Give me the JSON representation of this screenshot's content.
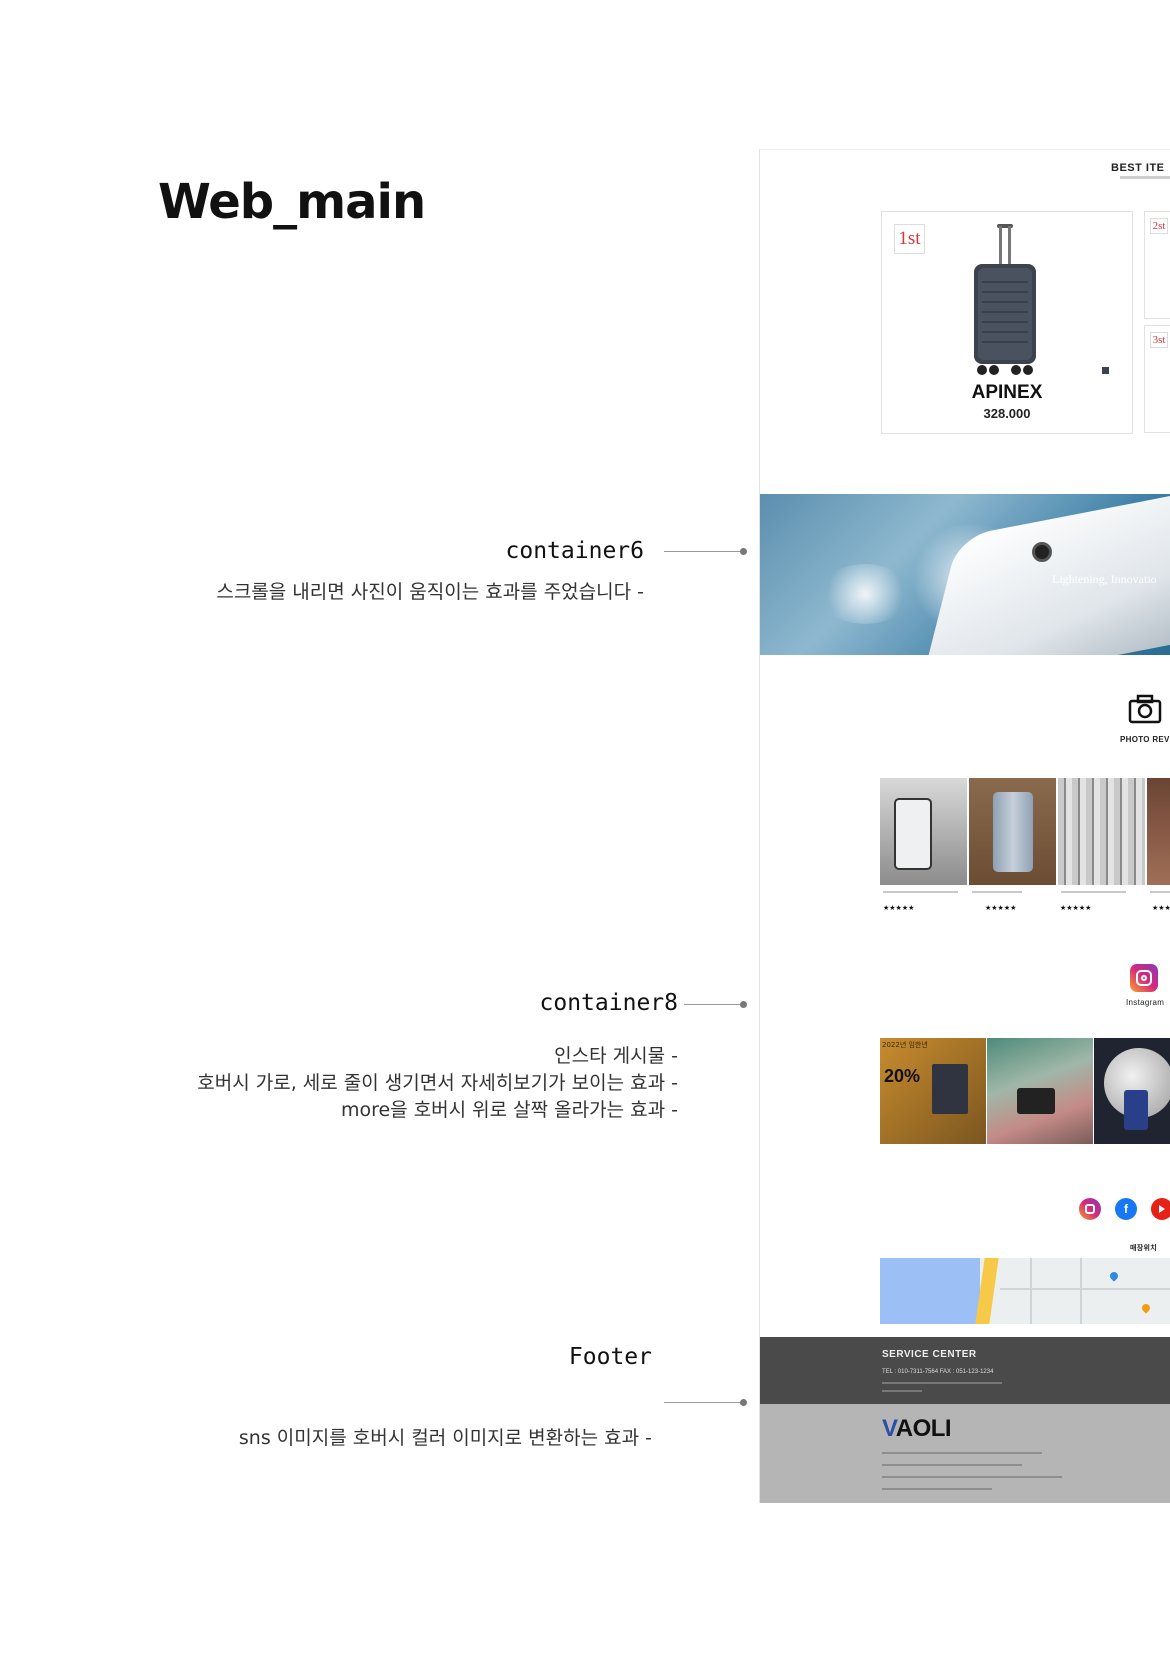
{
  "page": {
    "title": "Web_main"
  },
  "annotations": [
    {
      "title": "container6",
      "lines": [
        "스크롤을 내리면 사진이 움직이는 효과를 주었습니다 -"
      ]
    },
    {
      "title": "container8",
      "lines": [
        "인스타 게시물 -",
        "호버시 가로, 세로 줄이 생기면서 자세히보기가 보이는 효과 -",
        "more을 호버시 위로 살짝 올라가는 효과 -"
      ]
    },
    {
      "title": "Footer",
      "lines": [
        "sns 이미지를 호버시 컬러 이미지로 변환하는 효과 -"
      ]
    }
  ],
  "mockup": {
    "best_heading": "BEST  ITE",
    "best_product": {
      "rank": "1st",
      "name": "APINEX",
      "price": "328.000"
    },
    "side_ranks": [
      "2st",
      "3st"
    ],
    "banner_text": "Lightening, Innovatio",
    "photo_review_label": "PHOTO  REVI",
    "review_stars": [
      "★★★★★",
      "★★★★★",
      "★★★★★",
      "★★★"
    ],
    "instagram_label": "Instagram",
    "insta_promo": {
      "year": "2022년 임한년",
      "discount": "20%"
    },
    "sns_icons": [
      "instagram-icon",
      "facebook-icon",
      "youtube-icon"
    ],
    "store_location_label": "매장위치",
    "footer": {
      "service": "SERVICE   CENTER",
      "tel_line": "TEL  :  010-7311-7564   FAX  :  051-123-1234",
      "logo": "AOLI",
      "logo_mark": "V"
    }
  },
  "colors": {
    "accent_red": "#d9343a",
    "footer_dark": "#4a4a4a",
    "footer_light": "#b5b5b5",
    "instagram": "#d6287a",
    "facebook": "#1877f2",
    "youtube": "#e62117"
  }
}
